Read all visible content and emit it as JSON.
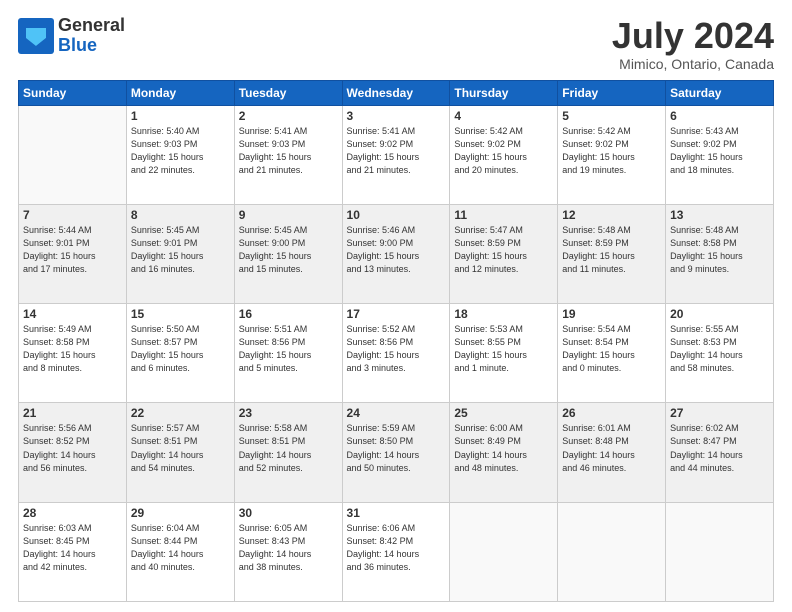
{
  "logo": {
    "general": "General",
    "blue": "Blue"
  },
  "header": {
    "month": "July 2024",
    "location": "Mimico, Ontario, Canada"
  },
  "weekdays": [
    "Sunday",
    "Monday",
    "Tuesday",
    "Wednesday",
    "Thursday",
    "Friday",
    "Saturday"
  ],
  "weeks": [
    [
      {
        "day": "",
        "info": ""
      },
      {
        "day": "1",
        "info": "Sunrise: 5:40 AM\nSunset: 9:03 PM\nDaylight: 15 hours\nand 22 minutes."
      },
      {
        "day": "2",
        "info": "Sunrise: 5:41 AM\nSunset: 9:03 PM\nDaylight: 15 hours\nand 21 minutes."
      },
      {
        "day": "3",
        "info": "Sunrise: 5:41 AM\nSunset: 9:02 PM\nDaylight: 15 hours\nand 21 minutes."
      },
      {
        "day": "4",
        "info": "Sunrise: 5:42 AM\nSunset: 9:02 PM\nDaylight: 15 hours\nand 20 minutes."
      },
      {
        "day": "5",
        "info": "Sunrise: 5:42 AM\nSunset: 9:02 PM\nDaylight: 15 hours\nand 19 minutes."
      },
      {
        "day": "6",
        "info": "Sunrise: 5:43 AM\nSunset: 9:02 PM\nDaylight: 15 hours\nand 18 minutes."
      }
    ],
    [
      {
        "day": "7",
        "info": "Sunrise: 5:44 AM\nSunset: 9:01 PM\nDaylight: 15 hours\nand 17 minutes."
      },
      {
        "day": "8",
        "info": "Sunrise: 5:45 AM\nSunset: 9:01 PM\nDaylight: 15 hours\nand 16 minutes."
      },
      {
        "day": "9",
        "info": "Sunrise: 5:45 AM\nSunset: 9:00 PM\nDaylight: 15 hours\nand 15 minutes."
      },
      {
        "day": "10",
        "info": "Sunrise: 5:46 AM\nSunset: 9:00 PM\nDaylight: 15 hours\nand 13 minutes."
      },
      {
        "day": "11",
        "info": "Sunrise: 5:47 AM\nSunset: 8:59 PM\nDaylight: 15 hours\nand 12 minutes."
      },
      {
        "day": "12",
        "info": "Sunrise: 5:48 AM\nSunset: 8:59 PM\nDaylight: 15 hours\nand 11 minutes."
      },
      {
        "day": "13",
        "info": "Sunrise: 5:48 AM\nSunset: 8:58 PM\nDaylight: 15 hours\nand 9 minutes."
      }
    ],
    [
      {
        "day": "14",
        "info": "Sunrise: 5:49 AM\nSunset: 8:58 PM\nDaylight: 15 hours\nand 8 minutes."
      },
      {
        "day": "15",
        "info": "Sunrise: 5:50 AM\nSunset: 8:57 PM\nDaylight: 15 hours\nand 6 minutes."
      },
      {
        "day": "16",
        "info": "Sunrise: 5:51 AM\nSunset: 8:56 PM\nDaylight: 15 hours\nand 5 minutes."
      },
      {
        "day": "17",
        "info": "Sunrise: 5:52 AM\nSunset: 8:56 PM\nDaylight: 15 hours\nand 3 minutes."
      },
      {
        "day": "18",
        "info": "Sunrise: 5:53 AM\nSunset: 8:55 PM\nDaylight: 15 hours\nand 1 minute."
      },
      {
        "day": "19",
        "info": "Sunrise: 5:54 AM\nSunset: 8:54 PM\nDaylight: 15 hours\nand 0 minutes."
      },
      {
        "day": "20",
        "info": "Sunrise: 5:55 AM\nSunset: 8:53 PM\nDaylight: 14 hours\nand 58 minutes."
      }
    ],
    [
      {
        "day": "21",
        "info": "Sunrise: 5:56 AM\nSunset: 8:52 PM\nDaylight: 14 hours\nand 56 minutes."
      },
      {
        "day": "22",
        "info": "Sunrise: 5:57 AM\nSunset: 8:51 PM\nDaylight: 14 hours\nand 54 minutes."
      },
      {
        "day": "23",
        "info": "Sunrise: 5:58 AM\nSunset: 8:51 PM\nDaylight: 14 hours\nand 52 minutes."
      },
      {
        "day": "24",
        "info": "Sunrise: 5:59 AM\nSunset: 8:50 PM\nDaylight: 14 hours\nand 50 minutes."
      },
      {
        "day": "25",
        "info": "Sunrise: 6:00 AM\nSunset: 8:49 PM\nDaylight: 14 hours\nand 48 minutes."
      },
      {
        "day": "26",
        "info": "Sunrise: 6:01 AM\nSunset: 8:48 PM\nDaylight: 14 hours\nand 46 minutes."
      },
      {
        "day": "27",
        "info": "Sunrise: 6:02 AM\nSunset: 8:47 PM\nDaylight: 14 hours\nand 44 minutes."
      }
    ],
    [
      {
        "day": "28",
        "info": "Sunrise: 6:03 AM\nSunset: 8:45 PM\nDaylight: 14 hours\nand 42 minutes."
      },
      {
        "day": "29",
        "info": "Sunrise: 6:04 AM\nSunset: 8:44 PM\nDaylight: 14 hours\nand 40 minutes."
      },
      {
        "day": "30",
        "info": "Sunrise: 6:05 AM\nSunset: 8:43 PM\nDaylight: 14 hours\nand 38 minutes."
      },
      {
        "day": "31",
        "info": "Sunrise: 6:06 AM\nSunset: 8:42 PM\nDaylight: 14 hours\nand 36 minutes."
      },
      {
        "day": "",
        "info": ""
      },
      {
        "day": "",
        "info": ""
      },
      {
        "day": "",
        "info": ""
      }
    ]
  ]
}
